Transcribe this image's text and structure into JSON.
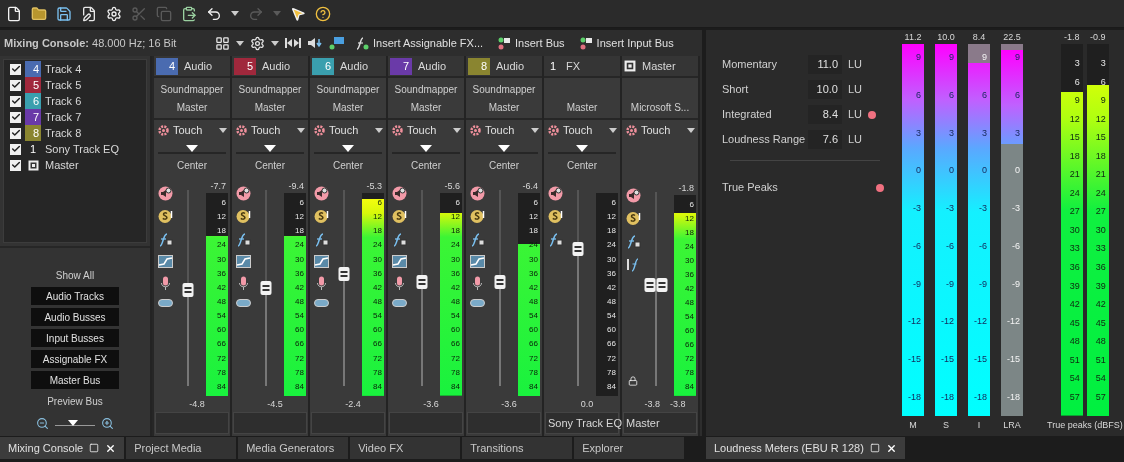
{
  "toolbar": [
    {
      "kind": "new",
      "disabled": false
    },
    {
      "kind": "open",
      "disabled": false
    },
    {
      "kind": "save",
      "disabled": false
    },
    {
      "kind": "save_as",
      "disabled": false
    },
    {
      "kind": "settings",
      "disabled": false
    },
    {
      "kind": "cut",
      "disabled": true
    },
    {
      "kind": "copy",
      "disabled": true
    },
    {
      "kind": "paste",
      "disabled": false
    },
    {
      "kind": "undo",
      "disabled": false
    },
    {
      "kind": "caret",
      "disabled": false
    },
    {
      "kind": "redo",
      "disabled": true
    },
    {
      "kind": "caret",
      "disabled": true
    },
    {
      "kind": "whats_this",
      "disabled": false
    },
    {
      "kind": "help",
      "disabled": false
    }
  ],
  "mixing_console": {
    "title": "**Mixing Console:** 48.000 Hz; 16 Bit",
    "tools": [
      {
        "kind": "layout"
      },
      {
        "kind": "caret"
      },
      {
        "kind": "settings"
      },
      {
        "kind": "caret"
      },
      {
        "kind": "trim"
      },
      {
        "kind": "downmix"
      },
      {
        "kind": "view"
      },
      {
        "kind": "insert_fx",
        "label": "Insert Assignable FX..."
      },
      {
        "kind": "insert_bus",
        "label": "Insert Bus"
      },
      {
        "kind": "insert_bus",
        "label": "Insert Input Bus"
      }
    ],
    "tracks": [
      {
        "kind": "track",
        "number": "4",
        "color": "#4a6bb0",
        "label": "Track 4",
        "checked": true
      },
      {
        "kind": "track",
        "number": "5",
        "color": "#a0283c",
        "label": "Track 5",
        "checked": true
      },
      {
        "kind": "track",
        "number": "6",
        "color": "#3a9fae",
        "label": "Track 6",
        "checked": true
      },
      {
        "kind": "track",
        "number": "7",
        "color": "#6a3aa8",
        "label": "Track 7",
        "checked": true
      },
      {
        "kind": "track",
        "number": "8",
        "color": "#8a8530",
        "label": "Track 8",
        "checked": true
      },
      {
        "kind": "fx",
        "number": "1",
        "label": "Sony Track EQ",
        "checked": true
      },
      {
        "kind": "master",
        "label": "Master",
        "checked": true
      }
    ],
    "filters": [
      {
        "label": "Show All",
        "selected": false
      },
      {
        "label": "Audio Tracks",
        "selected": true
      },
      {
        "label": "Audio Busses",
        "selected": true
      },
      {
        "label": "Input Busses",
        "selected": true
      },
      {
        "label": "Assignable FX",
        "selected": true
      },
      {
        "label": "Master Bus",
        "selected": true
      },
      {
        "label": "Preview Bus",
        "selected": false
      }
    ],
    "zoom": {
      "level": 0.45
    },
    "channels": [
      {
        "kind": "audio",
        "number": "4",
        "color": "#4a6bb0",
        "type": "Audio",
        "routing": [
          "Soundmapper",
          "Master"
        ],
        "automation": "Touch",
        "pan": {
          "label": "Center",
          "level": 0.5
        },
        "peak": "-7.7",
        "meter": {
          "level": 0.79,
          "scale": [
            "6",
            "12",
            "18",
            "24",
            "30",
            "36",
            "42",
            "48",
            "54",
            "60",
            "66",
            "72",
            "78",
            "84"
          ]
        },
        "fader": {
          "level": 0.49
        },
        "gains": [
          "-4.8"
        ]
      },
      {
        "kind": "audio",
        "number": "5",
        "color": "#a0283c",
        "type": "Audio",
        "routing": [
          "Soundmapper",
          "Master"
        ],
        "automation": "Touch",
        "pan": {
          "label": "Center",
          "level": 0.5
        },
        "peak": "-9.4",
        "meter": {
          "level": 0.79,
          "scale": [
            "6",
            "12",
            "18",
            "24",
            "30",
            "36",
            "42",
            "48",
            "54",
            "60",
            "66",
            "72",
            "78",
            "84"
          ]
        },
        "fader": {
          "level": 0.5
        },
        "gains": [
          "-4.5"
        ]
      },
      {
        "kind": "audio",
        "number": "6",
        "color": "#3a9fae",
        "type": "Audio",
        "routing": [
          "Soundmapper",
          "Master"
        ],
        "automation": "Touch",
        "pan": {
          "label": "Center",
          "level": 0.5
        },
        "peak": "-5.3",
        "meter": {
          "level": 0.97,
          "scale": [
            "6",
            "12",
            "18",
            "24",
            "30",
            "36",
            "42",
            "48",
            "54",
            "60",
            "66",
            "72",
            "78",
            "84"
          ]
        },
        "fader": {
          "level": 0.57
        },
        "gains": [
          "-2.4"
        ]
      },
      {
        "kind": "audio",
        "number": "7",
        "color": "#6a3aa8",
        "type": "Audio",
        "routing": [
          "Soundmapper",
          "Master"
        ],
        "automation": "Touch",
        "pan": {
          "label": "Center",
          "level": 0.5
        },
        "peak": "-5.6",
        "meter": {
          "level": 0.9,
          "scale": [
            "6",
            "12",
            "18",
            "24",
            "30",
            "36",
            "42",
            "48",
            "54",
            "60",
            "66",
            "72",
            "78",
            "84"
          ]
        },
        "fader": {
          "level": 0.53
        },
        "gains": [
          "-3.6"
        ]
      },
      {
        "kind": "audio",
        "number": "8",
        "color": "#8a8530",
        "type": "Audio",
        "routing": [
          "Soundmapper",
          "Master"
        ],
        "automation": "Touch",
        "pan": {
          "label": "Center",
          "level": 0.5
        },
        "peak": "-6.4",
        "meter": {
          "level": 0.75,
          "scale": [
            "6",
            "12",
            "18",
            "24",
            "30",
            "36",
            "42",
            "48",
            "54",
            "60",
            "66",
            "72",
            "78",
            "84"
          ]
        },
        "fader": {
          "level": 0.53
        },
        "gains": [
          "-3.6"
        ]
      },
      {
        "kind": "fx",
        "number": "1",
        "type": "FX",
        "routing": [
          "Master"
        ],
        "automation": "Touch",
        "pan": {
          "label": "Center",
          "level": 0.5
        },
        "meter": {
          "level": 0,
          "scale": [
            "6",
            "12",
            "18",
            "24",
            "30",
            "36",
            "42",
            "48",
            "54",
            "60",
            "66",
            "72",
            "78",
            "84"
          ]
        },
        "fader": {
          "level": 0.7
        },
        "gains": [
          "0.0"
        ],
        "name": "Sony Track EQ"
      },
      {
        "kind": "master",
        "type": "Master",
        "routing": [
          "Microsoft S..."
        ],
        "automation": "Touch",
        "peak": "-1.8",
        "meter": {
          "level": 0.91,
          "scale": [
            "6",
            "12",
            "18",
            "24",
            "30",
            "36",
            "42",
            "48",
            "54",
            "60",
            "66",
            "72",
            "78",
            "84"
          ]
        },
        "fader": {
          "level": 0.52
        },
        "gains": [
          "-3.8",
          "-3.8"
        ],
        "name": "Master"
      }
    ]
  },
  "loudness": {
    "stats": [
      {
        "label": "Momentary",
        "value": "11.0",
        "unit": "LU",
        "alert": false
      },
      {
        "label": "Short",
        "value": "10.0",
        "unit": "LU",
        "alert": false
      },
      {
        "label": "Integrated",
        "value": "8.4",
        "unit": "LU",
        "alert": true
      },
      {
        "label": "Loudness Range",
        "value": "7.6",
        "unit": "LU",
        "alert": false
      },
      {
        "label": "True Peaks",
        "alert": true
      }
    ],
    "meters": [
      {
        "kind": "loudness",
        "label": "M",
        "reading": "11.2",
        "level": 1,
        "scale": [
          "9",
          "6",
          "3",
          "0",
          "-3",
          "-6",
          "-9",
          "-12",
          "-15",
          "-18"
        ]
      },
      {
        "kind": "loudness",
        "label": "S",
        "reading": "10.0",
        "level": 1,
        "scale": [
          "9",
          "6",
          "3",
          "0",
          "-3",
          "-6",
          "-9",
          "-12",
          "-15",
          "-18"
        ]
      },
      {
        "kind": "loudness",
        "label": "I",
        "reading": "8.4",
        "level": 0.95,
        "scale": [
          "9",
          "6",
          "3",
          "0",
          "-3",
          "-6",
          "-9",
          "-12",
          "-15",
          "-18"
        ]
      },
      {
        "kind": "range",
        "label": "LRA",
        "reading": "22.5",
        "level": 0.73,
        "scale": [
          "9",
          "6",
          "3",
          "0",
          "-3",
          "-6",
          "-9",
          "-12",
          "-15",
          "-18"
        ]
      }
    ],
    "true_peaks": {
      "label": "True peaks (dBFS)",
      "meters": [
        {
          "reading": "-1.8",
          "level": 0.87,
          "scale": [
            "3",
            "6",
            "9",
            "12",
            "15",
            "18",
            "21",
            "24",
            "27",
            "30",
            "33",
            "36",
            "39",
            "42",
            "45",
            "48",
            "51",
            "54",
            "57"
          ]
        },
        {
          "reading": "-0.9",
          "level": 0.89,
          "scale": [
            "3",
            "6",
            "9",
            "12",
            "15",
            "18",
            "21",
            "24",
            "27",
            "30",
            "33",
            "36",
            "39",
            "42",
            "45",
            "48",
            "51",
            "54",
            "57"
          ]
        }
      ]
    }
  },
  "bottom_tabs": {
    "left": [
      {
        "label": "Mixing Console",
        "selected": true
      },
      {
        "label": "Project Media",
        "selected": false
      },
      {
        "label": "Media Generators",
        "selected": false
      },
      {
        "label": "Video FX",
        "selected": false
      },
      {
        "label": "Transitions",
        "selected": false
      },
      {
        "label": "Explorer",
        "selected": false
      }
    ],
    "right": [
      {
        "label": "Loudness Meters (EBU R 128)",
        "selected": true
      }
    ]
  }
}
